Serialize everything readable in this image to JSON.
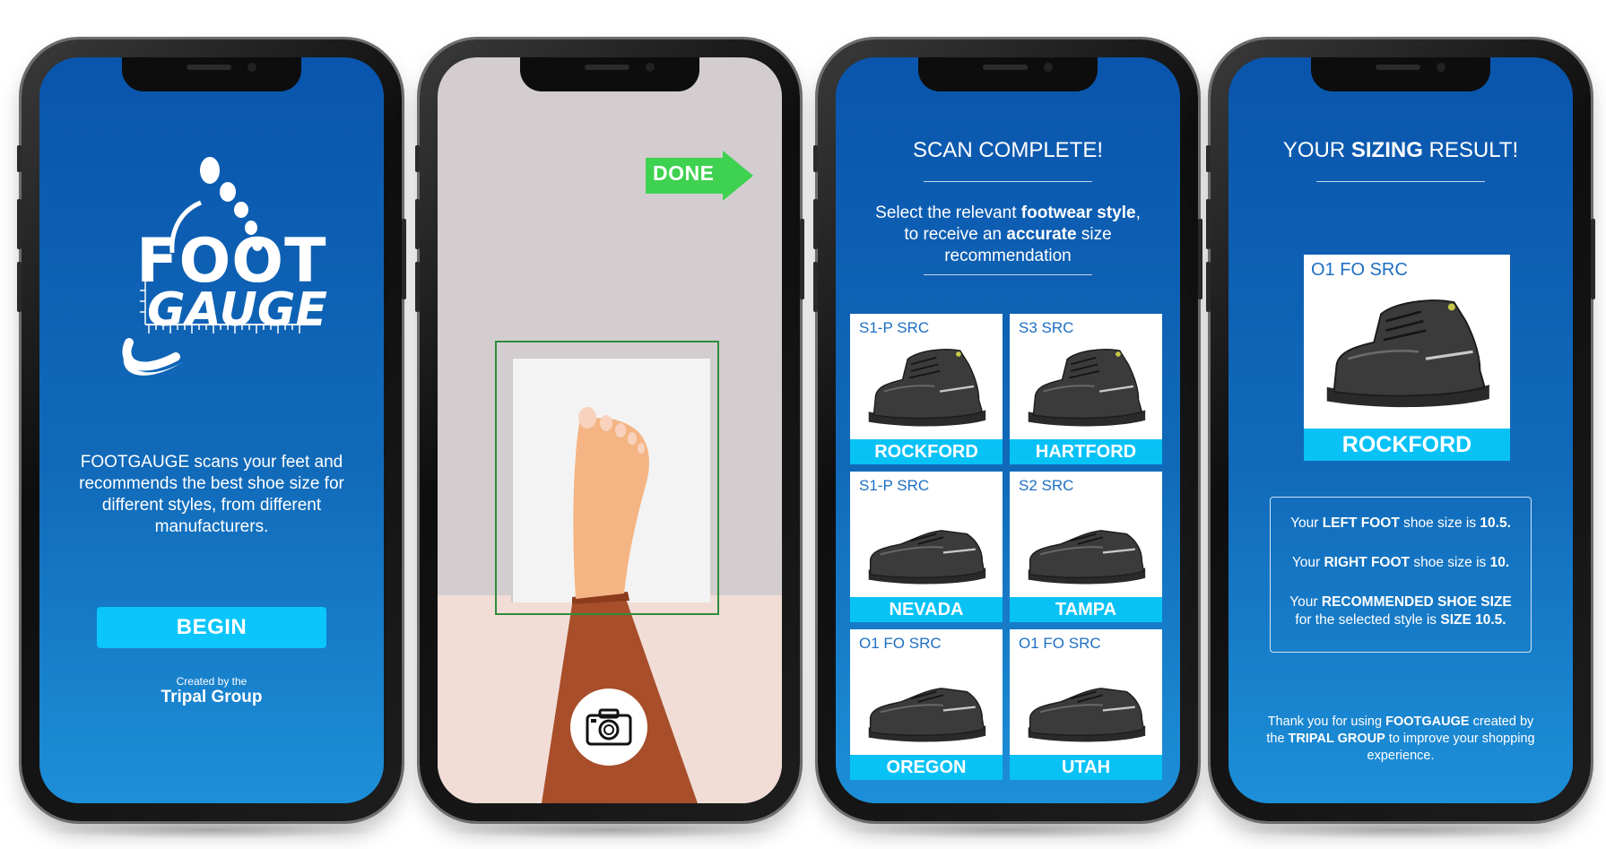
{
  "screen1": {
    "logo_top": "FOOT",
    "logo_bottom": "GAUGE",
    "intro_brand": "FOOTGAUGE",
    "intro_rest": " scans your feet and recommends the best shoe size for different styles, from different manufacturers.",
    "begin_label": "BEGIN",
    "created_by": "Created by the",
    "group_name": "Tripal Group"
  },
  "screen2": {
    "done_label": "DONE",
    "shutter_icon": "camera-icon"
  },
  "screen3": {
    "title_bold": "SCAN",
    "title_rest": " COMPLETE!",
    "instr_1": "Select the relevant ",
    "instr_em1": "footwear style",
    "instr_2": ", to receive an ",
    "instr_em2": "accurate",
    "instr_3": " size recommendation",
    "cards": [
      {
        "code": "S1-P SRC",
        "name": "ROCKFORD",
        "kind": "boot"
      },
      {
        "code": "S3 SRC",
        "name": "HARTFORD",
        "kind": "boot"
      },
      {
        "code": "S1-P SRC",
        "name": "NEVADA",
        "kind": "low"
      },
      {
        "code": "S2 SRC",
        "name": "TAMPA",
        "kind": "low"
      },
      {
        "code": "O1 FO SRC",
        "name": "OREGON",
        "kind": "low"
      },
      {
        "code": "O1 FO SRC",
        "name": "UTAH",
        "kind": "low"
      }
    ]
  },
  "screen4": {
    "title_1": "YOUR ",
    "title_bold": "SIZING",
    "title_2": " RESULT!",
    "result_code": "O1 FO SRC",
    "result_name": "ROCKFORD",
    "left_1": "Your ",
    "left_em": "LEFT FOOT",
    "left_2": " shoe size is ",
    "left_size": "10.5.",
    "right_1": "Your ",
    "right_em": "RIGHT FOOT",
    "right_2": " shoe size is ",
    "right_size": "10.",
    "rec_1": "Your ",
    "rec_em": "RECOMMENDED SHOE SIZE",
    "rec_2": "for the selected style is ",
    "rec_size": "SIZE 10.5.",
    "thanks_1": "Thank you for using ",
    "thanks_em1": "FOOTGAUGE",
    "thanks_2": " created by the ",
    "thanks_em2": "TRIPAL GROUP",
    "thanks_3": " to improve your shopping experience."
  },
  "colors": {
    "accent": "#08c2f6",
    "screen_blue": "#0a55ad",
    "done_green": "#3fd150"
  }
}
